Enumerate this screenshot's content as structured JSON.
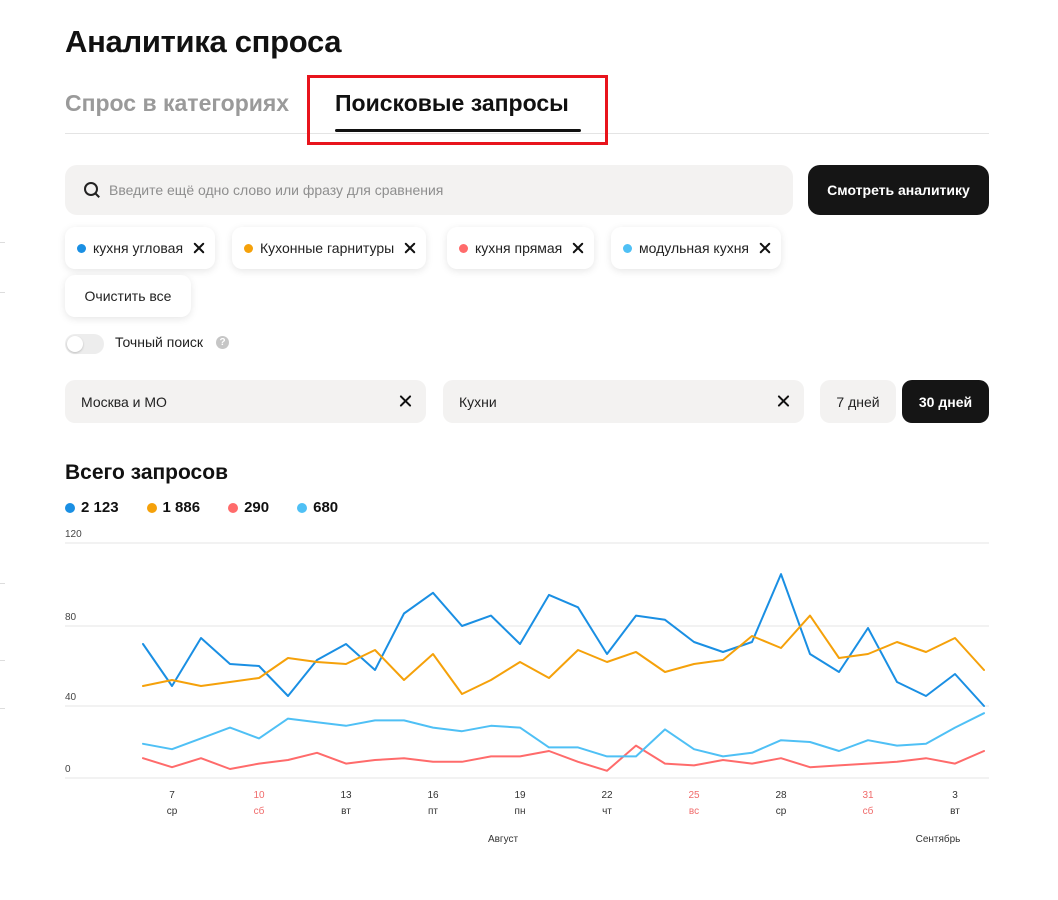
{
  "page_title": "Аналитика спроса",
  "tabs": [
    {
      "label": "Спрос в категориях",
      "active": false
    },
    {
      "label": "Поисковые запросы",
      "active": true
    }
  ],
  "search": {
    "placeholder": "Введите ещё одно слово или фразу для сравнения",
    "value": ""
  },
  "analytics_button": "Смотреть аналитику",
  "chips": [
    {
      "label": "кухня угловая",
      "color": "#1a8fe3"
    },
    {
      "label": "Кухонные гарнитуры",
      "color": "#f5a10a"
    },
    {
      "label": "кухня прямая",
      "color": "#ff6b6b"
    },
    {
      "label": "модульная кухня",
      "color": "#4fc0f5"
    }
  ],
  "clear_all": "Очистить все",
  "exact_search": {
    "label": "Точный поиск",
    "enabled": false
  },
  "region_filter": "Москва и МО",
  "category_filter": "Кухни",
  "periods": [
    {
      "label": "7 дней",
      "active": false
    },
    {
      "label": "30 дней",
      "active": true
    }
  ],
  "chart_title": "Всего запросов",
  "legend_totals": [
    "2 123",
    "1 886",
    "290",
    "680"
  ],
  "chart_data": {
    "type": "line",
    "title": "Всего запросов",
    "ylim": [
      0,
      120
    ],
    "y_ticks": [
      "120",
      "80",
      "40",
      "0"
    ],
    "grid": true,
    "x": [
      "6",
      "7",
      "8",
      "9",
      "10",
      "11",
      "12",
      "13",
      "14",
      "15",
      "16",
      "17",
      "18",
      "19",
      "20",
      "21",
      "22",
      "23",
      "24",
      "25",
      "26",
      "27",
      "28",
      "29",
      "30",
      "31",
      "1",
      "2",
      "3",
      "4"
    ],
    "x_tick_labels": [
      {
        "day": "7",
        "weekday": "ср",
        "weekend": false
      },
      {
        "day": "10",
        "weekday": "сб",
        "weekend": true
      },
      {
        "day": "13",
        "weekday": "вт",
        "weekend": false
      },
      {
        "day": "16",
        "weekday": "пт",
        "weekend": false
      },
      {
        "day": "19",
        "weekday": "пн",
        "weekend": false
      },
      {
        "day": "22",
        "weekday": "чт",
        "weekend": false
      },
      {
        "day": "25",
        "weekday": "вс",
        "weekend": true
      },
      {
        "day": "28",
        "weekday": "ср",
        "weekend": false
      },
      {
        "day": "31",
        "weekday": "сб",
        "weekend": true
      },
      {
        "day": "3",
        "weekday": "вт",
        "weekend": false
      }
    ],
    "month_labels": [
      "Август",
      "Сентябрь"
    ],
    "series": [
      {
        "legend_value": "2 123",
        "color": "#1a8fe3",
        "values": [
          71,
          50,
          74,
          61,
          60,
          45,
          63,
          71,
          58,
          86,
          96,
          80,
          85,
          71,
          95,
          89,
          66,
          85,
          83,
          72,
          67,
          72,
          105,
          66,
          57,
          79,
          52,
          45,
          56,
          40
        ]
      },
      {
        "legend_value": "1 886",
        "color": "#f5a10a",
        "values": [
          50,
          53,
          50,
          52,
          54,
          64,
          62,
          61,
          68,
          53,
          66,
          46,
          53,
          62,
          54,
          68,
          62,
          67,
          57,
          61,
          63,
          75,
          69,
          85,
          64,
          66,
          72,
          67,
          74,
          58
        ]
      },
      {
        "legend_value": "290",
        "color": "#ff6b6b",
        "values": [
          11,
          6,
          11,
          5,
          8,
          10,
          14,
          8,
          10,
          11,
          9,
          9,
          12,
          12,
          15,
          9,
          4,
          18,
          8,
          7,
          10,
          8,
          11,
          6,
          7,
          8,
          9,
          11,
          8,
          15
        ]
      },
      {
        "legend_value": "680",
        "color": "#4fc0f5",
        "values": [
          19,
          16,
          22,
          28,
          22,
          33,
          31,
          29,
          32,
          32,
          28,
          26,
          29,
          28,
          17,
          17,
          12,
          12,
          27,
          16,
          12,
          14,
          21,
          20,
          15,
          21,
          18,
          19,
          28,
          36
        ]
      }
    ]
  }
}
